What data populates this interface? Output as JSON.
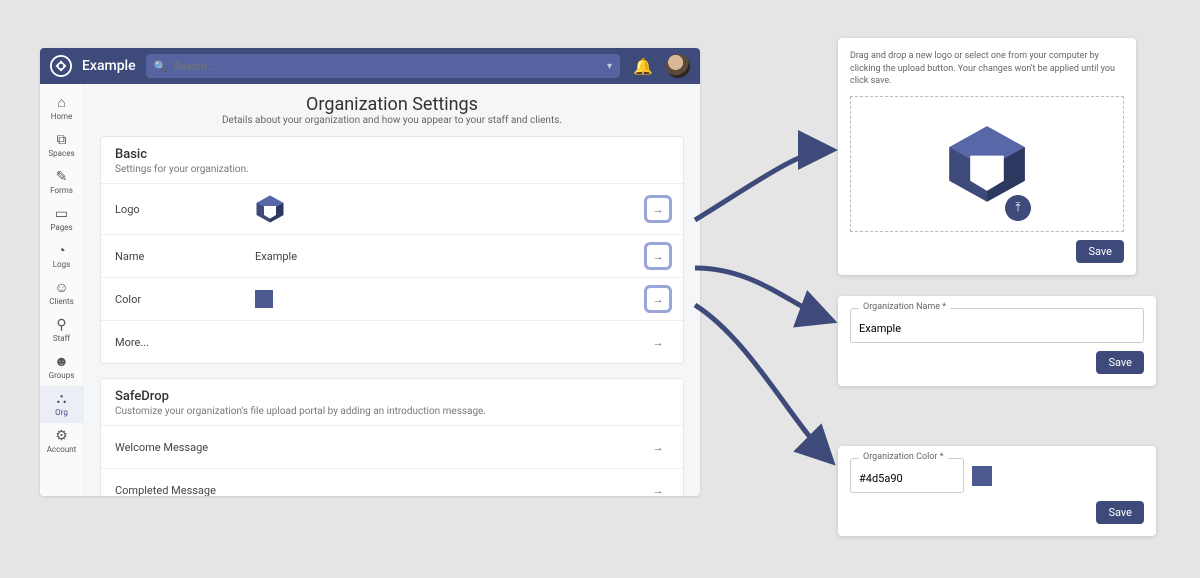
{
  "brand": {
    "name": "Example"
  },
  "search": {
    "placeholder": "Search..."
  },
  "nav": [
    {
      "icon": "⌂",
      "label": "Home"
    },
    {
      "icon": "⧉",
      "label": "Spaces"
    },
    {
      "icon": "✎",
      "label": "Forms"
    },
    {
      "icon": "▭",
      "label": "Pages"
    },
    {
      "icon": "◔",
      "label": "Logs"
    },
    {
      "icon": "☺",
      "label": "Clients"
    },
    {
      "icon": "⚲",
      "label": "Staff"
    },
    {
      "icon": "☻",
      "label": "Groups"
    },
    {
      "icon": "⛬",
      "label": "Org",
      "active": true
    },
    {
      "icon": "⚙",
      "label": "Account"
    }
  ],
  "page": {
    "title": "Organization Settings",
    "subtitle": "Details about your organization and how you appear to your staff and clients."
  },
  "sections": {
    "basic": {
      "title": "Basic",
      "subtitle": "Settings for your organization.",
      "rows": {
        "logo": {
          "label": "Logo"
        },
        "name": {
          "label": "Name",
          "value": "Example"
        },
        "color": {
          "label": "Color",
          "value": "#4d5a90"
        },
        "more": {
          "label": "More..."
        }
      }
    },
    "safedrop": {
      "title": "SafeDrop",
      "subtitle": "Customize your organization's file upload portal by adding an introduction message.",
      "rows": {
        "welcome": {
          "label": "Welcome Message"
        },
        "completed": {
          "label": "Completed Message"
        }
      }
    }
  },
  "popouts": {
    "logo": {
      "hint": "Drag and drop a new logo or select one from your computer by clicking the upload button. Your changes won't be applied until you click save.",
      "save": "Save"
    },
    "name": {
      "legend": "Organization Name *",
      "value": "Example",
      "save": "Save"
    },
    "color": {
      "legend": "Organization Color *",
      "value": "#4d5a90",
      "save": "Save"
    }
  },
  "colors": {
    "primary": "#4d5a90"
  }
}
